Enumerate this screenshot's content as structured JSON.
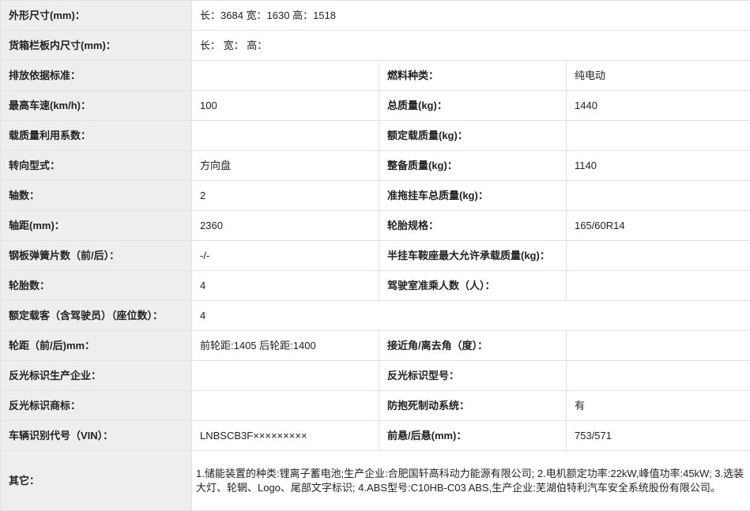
{
  "rows": [
    {
      "type": "wide",
      "label": "外形尺寸(mm)：",
      "value": "长：3684 宽：1630 高：1518"
    },
    {
      "type": "wide",
      "label": "货箱栏板内尺寸(mm)：",
      "value": "长： 宽： 高："
    },
    {
      "type": "pair",
      "label1": "排放依据标准：",
      "value1": "",
      "label2": "燃料种类：",
      "value2": "纯电动"
    },
    {
      "type": "pair",
      "label1": "最高车速(km/h)：",
      "value1": "100",
      "label2": "总质量(kg)：",
      "value2": "1440"
    },
    {
      "type": "pair",
      "label1": "载质量利用系数：",
      "value1": "",
      "label2": "额定载质量(kg)：",
      "value2": ""
    },
    {
      "type": "pair",
      "label1": "转向型式：",
      "value1": "方向盘",
      "label2": "整备质量(kg)：",
      "value2": "1140"
    },
    {
      "type": "pair",
      "label1": "轴数：",
      "value1": "2",
      "label2": "准拖挂车总质量(kg)：",
      "value2": ""
    },
    {
      "type": "pair",
      "label1": "轴距(mm)：",
      "value1": "2360",
      "label2": "轮胎规格：",
      "value2": "165/60R14"
    },
    {
      "type": "pair",
      "label1": "钢板弹簧片数（前/后）：",
      "value1": "-/-",
      "label2": "半挂车鞍座最大允许承载质量(kg)：",
      "value2": ""
    },
    {
      "type": "pair",
      "label1": "轮胎数：",
      "value1": "4",
      "label2": "驾驶室准乘人数（人）：",
      "value2": ""
    },
    {
      "type": "wide",
      "label": "额定载客（含驾驶员）（座位数）：",
      "value": "4"
    },
    {
      "type": "pair",
      "label1": "轮距（前/后)mm：",
      "value1": "前轮距:1405 后轮距:1400",
      "label2": "接近角/离去角（度）：",
      "value2": ""
    },
    {
      "type": "pair",
      "label1": "反光标识生产企业：",
      "value1": "",
      "label2": "反光标识型号：",
      "value2": ""
    },
    {
      "type": "pair",
      "label1": "反光标识商标：",
      "value1": "",
      "label2": "防抱死制动系统：",
      "value2": "有"
    },
    {
      "type": "pair",
      "label1": "车辆识别代号（VIN）：",
      "value1": "LNBSCB3F×××××××××",
      "label2": "前悬/后悬(mm)：",
      "value2": "753/571"
    },
    {
      "type": "note",
      "label": "其它：",
      "value": "1.储能装置的种类:锂离子蓄电池;生产企业:合肥国轩高科动力能源有限公司; 2.电机额定功率:22kW,峰值功率:45kW; 3.选装大灯、轮辋、Logo、尾部文字标识; 4.ABS型号:C10HB-C03 ABS,生产企业:芜湖伯特利汽车安全系统股份有限公司。"
    }
  ]
}
